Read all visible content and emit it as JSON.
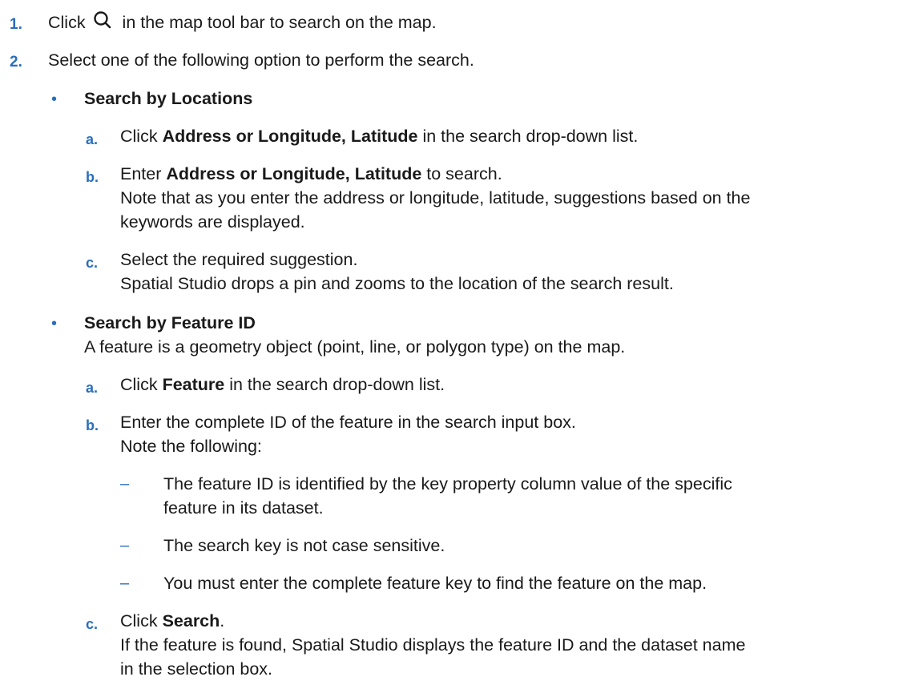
{
  "steps": [
    {
      "num": "1.",
      "pre": "Click",
      "icon": "search-icon",
      "post": " in the map tool bar to search on the map."
    },
    {
      "num": "2.",
      "text": "Select one of the following option to perform the search."
    }
  ],
  "sections": [
    {
      "bullet": "•",
      "title": "Search by Locations",
      "items": [
        {
          "letter": "a.",
          "pre": "Click ",
          "bold": "Address or Longitude, Latitude",
          "post": " in the search drop-down list."
        },
        {
          "letter": "b.",
          "pre": "Enter ",
          "bold": "Address or Longitude, Latitude",
          "post": " to search.",
          "note1": "Note that as you enter the address or longitude, latitude, suggestions based on the",
          "note2": "keywords are displayed."
        },
        {
          "letter": "c.",
          "text": "Select the required suggestion.",
          "note1": "Spatial Studio drops a pin and zooms to the location of the search result."
        }
      ]
    },
    {
      "bullet": "•",
      "title": "Search by Feature ID",
      "desc": "A feature is a geometry object (point, line, or polygon type) on the map.",
      "items": [
        {
          "letter": "a.",
          "pre": "Click ",
          "bold": "Feature",
          "post": " in the search drop-down list."
        },
        {
          "letter": "b.",
          "text": "Enter the complete ID of the feature in the search input box.",
          "note1": "Note the following:",
          "subs": [
            {
              "dash": "–",
              "line1": "The feature ID is identified by the key property column value of the specific",
              "line2": "feature in its dataset."
            },
            {
              "dash": "–",
              "line1": "The search key is not case sensitive."
            },
            {
              "dash": "–",
              "line1": "You must enter the complete feature key to find the feature on the map."
            }
          ]
        },
        {
          "letter": "c.",
          "pre": "Click ",
          "bold": "Search",
          "post": ".",
          "note1": "If the feature is found, Spatial Studio displays the feature ID and the dataset name",
          "note2": "in the selection box."
        }
      ]
    }
  ]
}
